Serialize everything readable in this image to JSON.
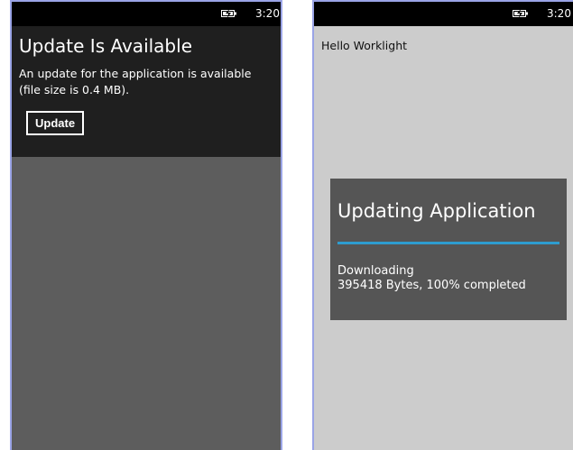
{
  "left_screen": {
    "status": {
      "time": "3:20",
      "battery_icon": "battery-charging-icon"
    },
    "dialog": {
      "title": "Update Is Available",
      "message": "An update for the application is available (file size is 0.4 MB).",
      "update_button_label": "Update"
    }
  },
  "right_screen": {
    "status": {
      "time": "3:20",
      "battery_icon": "battery-charging-icon"
    },
    "content_text": "Hello Worklight",
    "progress_dialog": {
      "title": "Updating Application",
      "progress_percent": 100,
      "status_line": "Downloading",
      "detail_line": "395418 Bytes, 100% completed"
    }
  },
  "colors": {
    "progress_accent": "#2e9ccf",
    "dialog_dark": "#1f1f1f",
    "frame_border": "#9aa4e6"
  }
}
